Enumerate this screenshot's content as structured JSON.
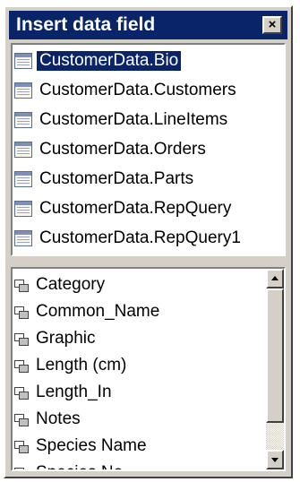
{
  "window": {
    "title": "Insert data field",
    "close_glyph": "×"
  },
  "tables": [
    {
      "label": "CustomerData.Bio",
      "selected": true
    },
    {
      "label": "CustomerData.Customers",
      "selected": false
    },
    {
      "label": "CustomerData.LineItems",
      "selected": false
    },
    {
      "label": "CustomerData.Orders",
      "selected": false
    },
    {
      "label": "CustomerData.Parts",
      "selected": false
    },
    {
      "label": "CustomerData.RepQuery",
      "selected": false
    },
    {
      "label": "CustomerData.RepQuery1",
      "selected": false
    }
  ],
  "fields": [
    {
      "label": "Category"
    },
    {
      "label": "Common_Name"
    },
    {
      "label": "Graphic"
    },
    {
      "label": "Length (cm)"
    },
    {
      "label": "Length_In"
    },
    {
      "label": "Notes"
    },
    {
      "label": "Species Name"
    },
    {
      "label": "Species No"
    }
  ],
  "colors": {
    "titlebar": "#0a246a",
    "selection": "#0a246a",
    "face": "#d4d0c8"
  }
}
